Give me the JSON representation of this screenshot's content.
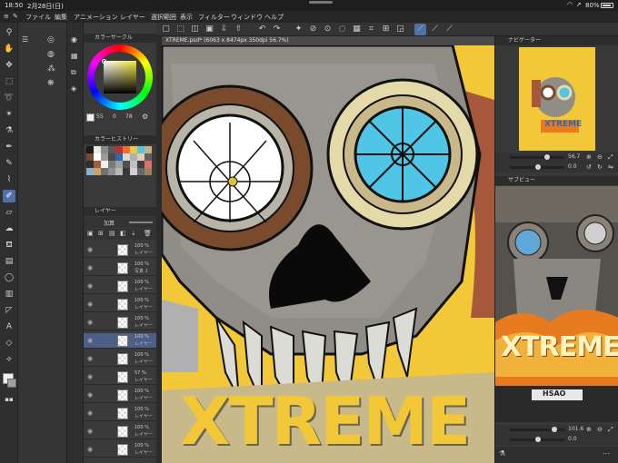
{
  "status": {
    "time": "18:50",
    "date": "2月28日(日)",
    "battery": "80%"
  },
  "menu": [
    "ファイル",
    "編集",
    "アニメーション",
    "レイヤー",
    "選択範囲",
    "表示",
    "フィルター",
    "ウィンドウ",
    "ヘルプ"
  ],
  "canvas": {
    "tab_title": "XTREME.psd* (6063 x 8474px 350dpi 56.7%)"
  },
  "panels": {
    "color_circle": {
      "title": "カラーサークル",
      "values": [
        "55",
        "0",
        "78"
      ]
    },
    "color_history": {
      "title": "カラーヒストリー"
    },
    "layer": {
      "title": "レイヤー",
      "blend_mode": "加算",
      "opacity": "100"
    },
    "navigator": {
      "title": "ナビゲーター",
      "zoom": "56.7",
      "rotation": "0.0"
    },
    "subview": {
      "title": "サブビュー",
      "zoom": "101.6",
      "rotation": "0.0"
    }
  },
  "layers": [
    {
      "opacity": "100 %",
      "name": "レイヤー"
    },
    {
      "opacity": "100 %",
      "name": "写真 1"
    },
    {
      "opacity": "100 %",
      "name": "レイヤー"
    },
    {
      "opacity": "100 %",
      "name": "レイヤー"
    },
    {
      "opacity": "100 %",
      "name": "レイヤー"
    },
    {
      "opacity": "100 %",
      "name": "レイヤー"
    },
    {
      "opacity": "100 %",
      "name": "レイヤー"
    },
    {
      "opacity": "57 %",
      "name": "レイヤー"
    },
    {
      "opacity": "100 %",
      "name": "レイヤー"
    },
    {
      "opacity": "100 %",
      "name": "レイヤー"
    },
    {
      "opacity": "100 %",
      "name": "レイヤー"
    },
    {
      "opacity": "100 %",
      "name": "レイヤー"
    }
  ],
  "artwork_text": {
    "xtreme": "XTREME",
    "logo": "XTREME",
    "sub_logo": "HSAO"
  },
  "colors": {
    "accent": "#6a8fd6",
    "canvas_bg": "#f2c738",
    "goggle_blue": "#4fc6e6",
    "goggle_brown": "#7a4a2c"
  },
  "history_swatches": [
    "#1a1a1a",
    "#e8e8e8",
    "#8a8a8a",
    "#5a5a5a",
    "#c03030",
    "#e87030",
    "#f2c738",
    "#4fc6e6",
    "#c8b08a",
    "#7a4a2c",
    "#ffffff",
    "#9a9a9a",
    "#4a4a4a",
    "#2a6ab0",
    "#d8d8d8",
    "#b0b0b0",
    "#e0d0b0",
    "#606060",
    "#303030",
    "#a06040",
    "#f0f0f0",
    "#7a7a7a",
    "#a0a0a0",
    "#505050",
    "#c0c0c0",
    "#404040",
    "#e07070",
    "#8ab0d0",
    "#d0a060",
    "#707070",
    "#909090",
    "#b8b8b8",
    "#383838",
    "#d0d0d0",
    "#606870",
    "#a08050"
  ]
}
